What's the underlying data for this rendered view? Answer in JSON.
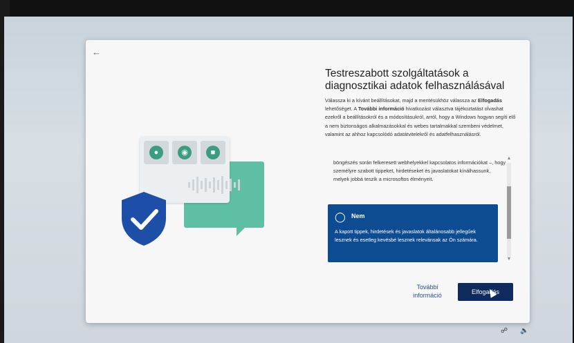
{
  "header": {
    "title": "Testreszabott szolgáltatások a diagnosztikai adatok felhasználásával",
    "back_icon": "arrow-left-icon"
  },
  "intro": {
    "part1": "Válassza ki a kívánt beállításokat, majd a mentésükhöz válassza az ",
    "bold1": "Elfogadás",
    "part2": " lehetőséget. A ",
    "bold2": "További információ",
    "part3": " hivatkozást választva tájékoztatást olvashat ezekről a beállításokról és a módosításukról, arról, hogy a Windows hogyan segíti elő a nem biztonságos alkalmazásokkal és webes tartalmakkal szembeni védelmet, valamint az ahhoz kapcsolódó adatátvitelekről és adatfelhasználásról."
  },
  "scroll_content": {
    "text": "böngészés során felkeresett webhelyekkel kapcsolatos információkat –, hogy személyre szabott tippeket, hirdetéseket és javaslatokat kínálhassunk, melyek jobbá teszik a microsoftos élményeit."
  },
  "option": {
    "title": "Nem",
    "icon": "lightbulb-icon",
    "description": "A kapott tippek, hirdetések és javaslatok általánosabb jellegűek lesznek és esetleg kevésbé lesznek relevánsak az Ön számára."
  },
  "buttons": {
    "more_info": "További információ",
    "accept": "Elfogadás"
  },
  "colors": {
    "primary": "#0f2a5c",
    "option_bg": "#0e4c92",
    "accent_green": "#5fbfa4",
    "shield": "#1e4fa8"
  }
}
